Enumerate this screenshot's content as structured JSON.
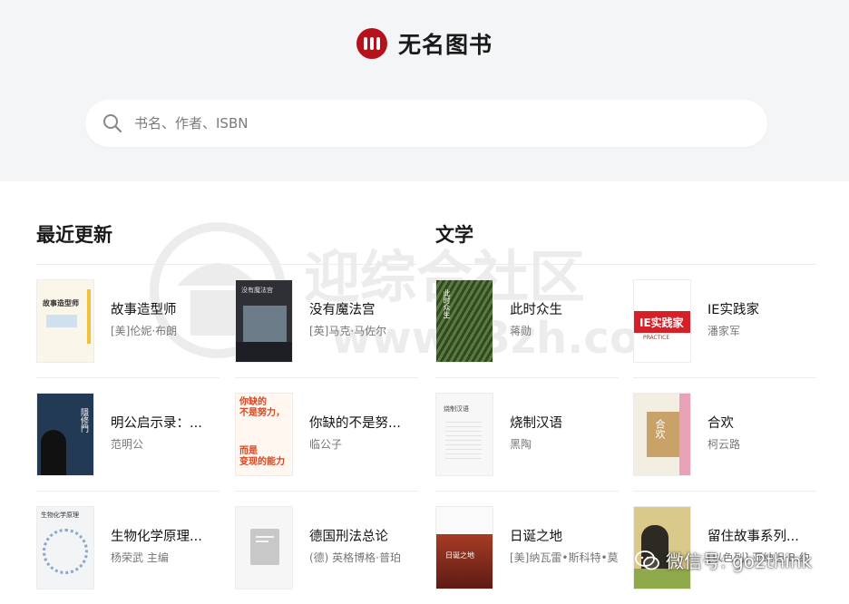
{
  "brand": {
    "name": "无名图书",
    "accent": "#b5121b"
  },
  "search": {
    "placeholder": "书名、作者、ISBN",
    "icon": "search-icon"
  },
  "sections": [
    {
      "title": "最近更新"
    },
    {
      "title": "文学"
    }
  ],
  "recent": [
    {
      "title": "故事造型师",
      "author": "[美]伦妮·布朗"
    },
    {
      "title": "没有魔法宫",
      "author": "[英]马克·马佐尔"
    },
    {
      "title": "明公启示录：...",
      "author": "范明公"
    },
    {
      "title": "你缺的不是努...",
      "author": "临公子"
    },
    {
      "title": "生物化学原理...",
      "author": "杨荣武 主编"
    },
    {
      "title": "德国刑法总论",
      "author": "(德) 英格博格·普珀"
    }
  ],
  "literature": [
    {
      "title": "此时众生",
      "author": "蒋勋"
    },
    {
      "title": "IE实践家",
      "author": "潘家军"
    },
    {
      "title": "烧制汉语",
      "author": "黑陶"
    },
    {
      "title": "合欢",
      "author": "柯云路"
    },
    {
      "title": "日诞之地",
      "author": "[美]纳瓦雷•斯科特•莫马"
    },
    {
      "title": "留住故事系列...",
      "author": "[以色列] 亚纳坦·B.约"
    }
  ],
  "covers": {
    "c0": {
      "text": "故事造型师"
    },
    "c1": {
      "text": "没有魔法宫"
    },
    "c2": {
      "text": "隱修門"
    },
    "c3": {
      "line1": "你缺的",
      "line2": "不是努力，",
      "line3": "而是",
      "line4": "变现的能力"
    },
    "c4": {
      "text": "生物化学原理"
    },
    "c6": {
      "text": "此时众生"
    },
    "c7": {
      "text": "IE实践家",
      "sub": "PRACTICE"
    },
    "c8": {
      "text": "烧制汉语"
    },
    "c9": {
      "text": "合欢"
    },
    "c10": {
      "text": "日诞之地"
    }
  },
  "watermark": {
    "text1": "迎综合社区",
    "text2": "www.i3zh.com"
  },
  "wechat": {
    "label": "微信号: go2think",
    "icon": "wechat-icon"
  }
}
